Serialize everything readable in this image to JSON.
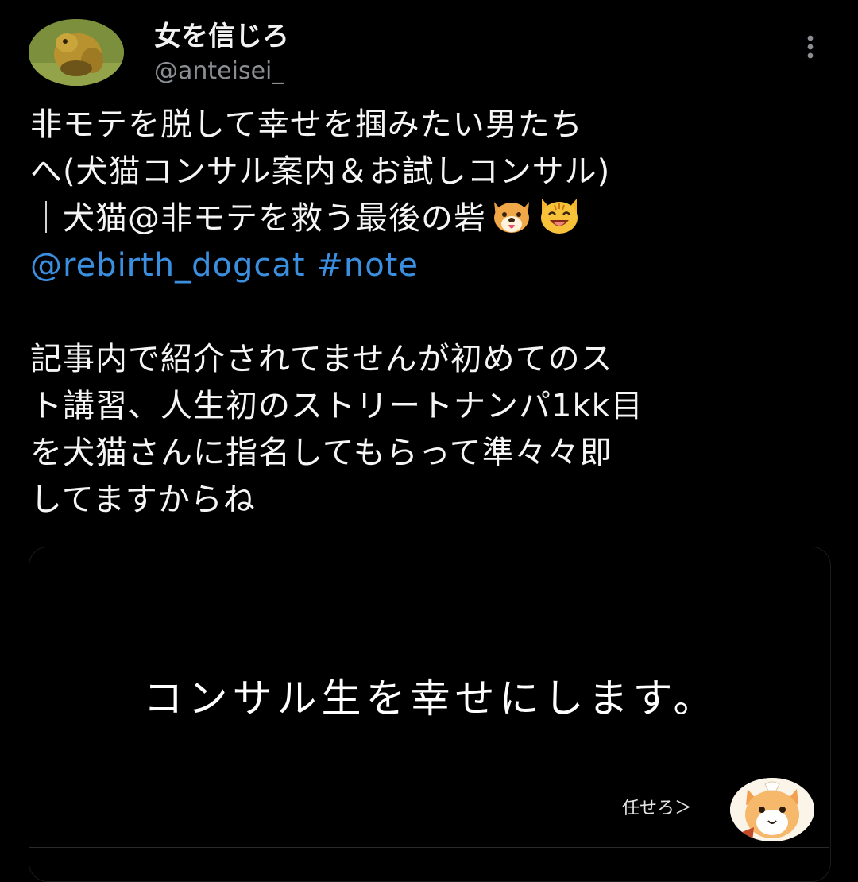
{
  "author": {
    "display_name": "女を信じろ",
    "handle": "@anteisei_"
  },
  "tweet": {
    "lines": [
      "非モテを脱して幸せを掴みたい男たち",
      "へ(犬猫コンサル案内＆お試しコンサル)",
      "｜犬猫@非モテを救う最後の砦"
    ],
    "mention": "@rebirth_dogcat",
    "hashtag": "#note",
    "body_lines": [
      "記事内で紹介されてませんが初めてのス",
      "ト講習、人生初のストリートナンパ1kk目",
      "を犬猫さんに指名してもらって準々々即",
      "してますからね"
    ]
  },
  "card": {
    "headline": "コンサル生を幸せにします。",
    "caption": "任せろ＞"
  },
  "icons": {
    "more": "more-vertical-icon",
    "dog_emoji": "dog-face-emoji",
    "cat_emoji": "cat-face-emoji"
  },
  "colors": {
    "background": "#000000",
    "link": "#3b8fe0",
    "secondary_text": "#8b8f94"
  }
}
